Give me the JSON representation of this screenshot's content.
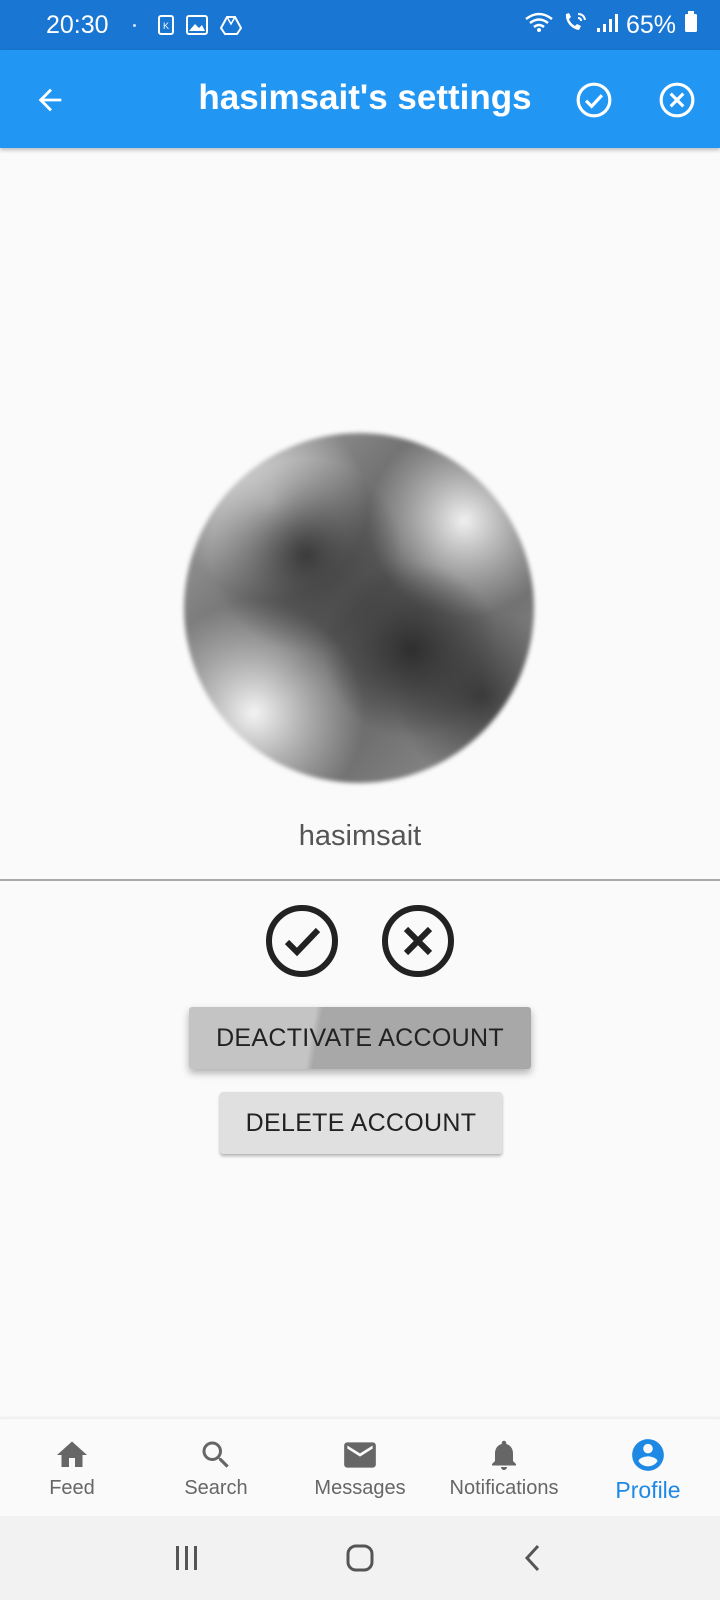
{
  "status_bar": {
    "time": "20:30",
    "battery": "65%",
    "icons": [
      "k-notification-icon",
      "gallery-icon",
      "drive-icon",
      "wifi-icon",
      "wifi-calling-icon",
      "signal-icon",
      "battery-icon"
    ]
  },
  "app_bar": {
    "title": "hasimsait's settings",
    "icons": [
      "back-arrow-icon",
      "check-circle-icon",
      "close-circle-icon"
    ],
    "color": "#2196f3"
  },
  "profile": {
    "username": "hasimsait"
  },
  "actions": {
    "deactivate_label": "DEACTIVATE ACCOUNT",
    "delete_label": "DELETE ACCOUNT"
  },
  "bottom_nav": {
    "items": [
      {
        "label": "Feed",
        "icon": "home-icon"
      },
      {
        "label": "Search",
        "icon": "search-icon"
      },
      {
        "label": "Messages",
        "icon": "mail-icon"
      },
      {
        "label": "Notifications",
        "icon": "bell-icon"
      },
      {
        "label": "Profile",
        "icon": "account-circle-icon",
        "active": true
      }
    ],
    "active_color": "#1e88e5"
  },
  "system_nav": {
    "icons": [
      "recents-icon",
      "home-icon",
      "back-icon"
    ]
  }
}
